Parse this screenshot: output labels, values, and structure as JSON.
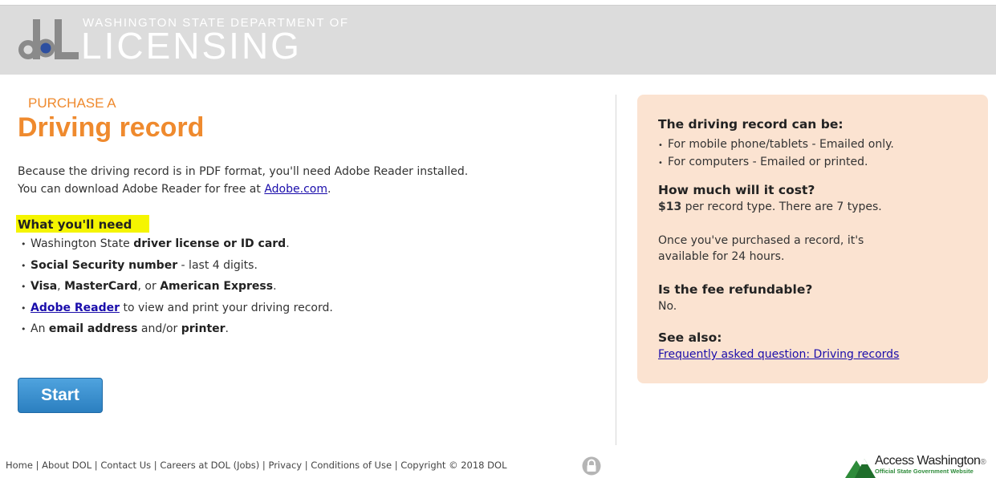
{
  "header": {
    "dept_line": "WASHINGTON STATE DEPARTMENT OF",
    "brand": "LICENSING",
    "logo_text": "dL"
  },
  "main": {
    "kicker": "PURCHASE A",
    "title": "Driving record",
    "intro_line1": "Because the driving record is in PDF format, you'll need Adobe Reader installed.",
    "intro_line2_prefix": "You can download Adobe Reader for free at ",
    "intro_link": "Adobe.com",
    "intro_line2_suffix": ".",
    "need_heading": "What you'll need",
    "needs": [
      {
        "pre": "Washington State ",
        "bold": "driver license or ID card",
        "post": "."
      },
      {
        "pre": "",
        "bold": "Social Security number",
        "post": " - last 4 digits."
      },
      {
        "pre": "",
        "bold": "Visa",
        "mid": ", ",
        "bold2": "MasterCard",
        "mid2": ", or ",
        "bold3": "American Express",
        "post": "."
      },
      {
        "link": "Adobe Reader",
        "post": " to view and print your driving record."
      },
      {
        "pre": "An ",
        "bold": "email address",
        "mid": " and/or ",
        "bold2": "printer",
        "post": "."
      }
    ],
    "start_label": "Start"
  },
  "sidebar": {
    "can_be_heading": "The driving record can be:",
    "can_be_items": [
      "For mobile phone/tablets - Emailed only.",
      "For computers - Emailed or printed."
    ],
    "cost_heading": "How much will it cost?",
    "cost_amount": "$13",
    "cost_text": " per record type. There are 7 types.",
    "availability_line1": "Once you've purchased a record, it's",
    "availability_line2": "available for 24 hours.",
    "refund_heading": "Is the fee refundable?",
    "refund_answer": "No.",
    "see_also_heading": "See also:",
    "see_also_link": "Frequently asked question: Driving records"
  },
  "footer": {
    "links": [
      "Home",
      "About DOL",
      "Contact Us",
      "Careers at DOL (Jobs)",
      "Privacy",
      "Conditions of Use"
    ],
    "copyright": "Copyright © 2018 DOL",
    "access_title": "Access Washington",
    "access_reg": "®",
    "access_subtitle": "Official State Government Website"
  },
  "colors": {
    "accent_orange": "#ef8a2e",
    "header_gray": "#dcdcdc",
    "sidebar_bg": "#fbe3d1",
    "highlight_yellow": "#f5f500",
    "button_blue": "#2b7fc0",
    "link_blue": "#1a0dab"
  },
  "icons": [
    "dol-logo-icon",
    "lock-icon",
    "access-washington-logo-icon"
  ]
}
